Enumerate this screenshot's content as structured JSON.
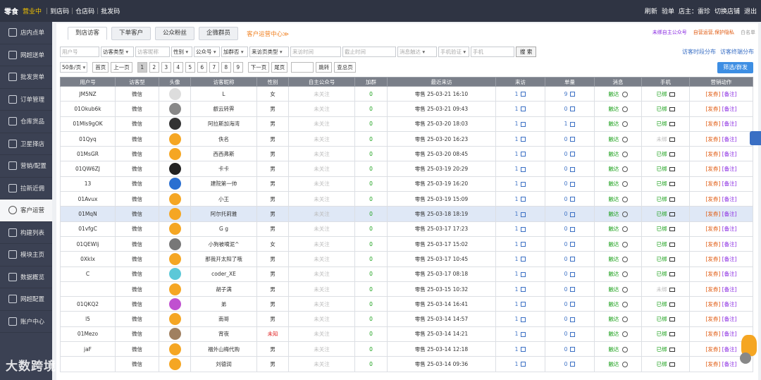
{
  "topbar": {
    "brand": "零食",
    "status": "营业中",
    "links": [
      "到店码",
      "仓店码",
      "批发码"
    ],
    "right": {
      "refresh": "刷新",
      "checkout": "验单",
      "owner": "店主：雷珍",
      "switch": "切换店铺",
      "exit": "退出"
    }
  },
  "sidebar": [
    "店内点单",
    "网超送单",
    "批发货单",
    "订单管理",
    "仓库货品",
    "卫星择店",
    "营销/配置",
    "拉新近佣",
    "客户运营",
    "构建列表",
    "模块主页",
    "数据概览",
    "网超配置",
    "账户中心"
  ],
  "watermark": "大数跨境",
  "tabs": {
    "items": [
      "到店访客",
      "下单客户",
      "公众粉丝",
      "企微群员"
    ],
    "link": "客户运营中心≫"
  },
  "notes": [
    "未绑自主公众号",
    "自营运营,保护隐私",
    "白名单"
  ],
  "filters": {
    "user_id": "用户号",
    "visitor_type": "访客类型",
    "nickname": "访客昵称",
    "gender": "性别",
    "official": "公众号",
    "group": "加群否",
    "page_type": "来访页类型",
    "visit_time": "来访时间",
    "end_time": "截止时间",
    "msg": "消息触达",
    "phone_verify": "手机验证",
    "phone": "手机",
    "search": "搜 索"
  },
  "filter_links": [
    "访客时段分布",
    "访客终端分布"
  ],
  "pager": {
    "per_page": "50条/页",
    "first": "首页",
    "prev": "上一页",
    "pages": [
      "1",
      "2",
      "3",
      "4",
      "5",
      "6",
      "7",
      "8",
      "9"
    ],
    "next": "下一页",
    "last": "尾页",
    "jump": "跳转",
    "total": "查总页"
  },
  "filter_button": "筛选/群发",
  "columns": [
    "用户号",
    "访客型",
    "头像",
    "访客昵称",
    "性别",
    "自主公众号",
    "加群",
    "最近来访",
    "来访",
    "单量",
    "消息",
    "手机",
    "营销动作"
  ],
  "rows": [
    {
      "id": "JM5NZ",
      "type": "微信",
      "name": "L",
      "gender": "女",
      "official": "未关注",
      "group": "0",
      "last": "零售 25-03-21 16:10",
      "visits": "1",
      "orders": "9",
      "msg": "触达",
      "phone": "已绑",
      "c1": "[发券]",
      "c2": "[备注]"
    },
    {
      "id": "01Okub6k",
      "type": "微信",
      "name": "叡云转霁",
      "gender": "男",
      "official": "未关注",
      "group": "0",
      "last": "零售 25-03-21 09:43",
      "visits": "1",
      "orders": "0",
      "msg": "触达",
      "phone": "已绑",
      "c1": "[发券]",
      "c2": "[备注]"
    },
    {
      "id": "01Mls9gOK",
      "type": "微信",
      "name": "阿拉斯加海湾",
      "gender": "男",
      "official": "未关注",
      "group": "0",
      "last": "零售 25-03-20 18:03",
      "visits": "1",
      "orders": "1",
      "msg": "触达",
      "phone": "已绑",
      "c1": "[发券]",
      "c2": "[备注]"
    },
    {
      "id": "01Qyq",
      "type": "微信",
      "name": "佚名",
      "gender": "男",
      "official": "未关注",
      "group": "0",
      "last": "零售 25-03-20 16:23",
      "visits": "1",
      "orders": "0",
      "msg": "触达",
      "phone": "未绑",
      "c1": "[发券]",
      "c2": "[备注]"
    },
    {
      "id": "01MsGR",
      "type": "微信",
      "name": "西西弗斯",
      "gender": "男",
      "official": "未关注",
      "group": "0",
      "last": "零售 25-03-20 08:45",
      "visits": "1",
      "orders": "0",
      "msg": "触达",
      "phone": "已绑",
      "c1": "[发券]",
      "c2": "[备注]"
    },
    {
      "id": "01QW6ZJ",
      "type": "微信",
      "name": "卡卡",
      "gender": "男",
      "official": "未关注",
      "group": "0",
      "last": "零售 25-03-19 20:29",
      "visits": "1",
      "orders": "0",
      "msg": "触达",
      "phone": "已绑",
      "c1": "[发券]",
      "c2": "[备注]"
    },
    {
      "id": "13",
      "type": "微信",
      "name": "建院第一帅",
      "gender": "男",
      "official": "未关注",
      "group": "0",
      "last": "零售 25-03-19 16:20",
      "visits": "1",
      "orders": "0",
      "msg": "触达",
      "phone": "已绑",
      "c1": "[发券]",
      "c2": "[备注]"
    },
    {
      "id": "01Avux",
      "type": "微信",
      "name": "小王",
      "gender": "男",
      "official": "未关注",
      "group": "0",
      "last": "零售 25-03-19 15:09",
      "visits": "1",
      "orders": "0",
      "msg": "触达",
      "phone": "已绑",
      "c1": "[发券]",
      "c2": "[备注]"
    },
    {
      "id": "01MqN",
      "type": "微信",
      "name": "阿尔托莉雅",
      "gender": "男",
      "official": "未关注",
      "group": "0",
      "last": "零售 25-03-18 18:19",
      "visits": "1",
      "orders": "0",
      "msg": "触达",
      "phone": "已绑",
      "c1": "[发券]",
      "c2": "[备注]"
    },
    {
      "id": "01vfgC",
      "type": "微信",
      "name": "G g",
      "gender": "男",
      "official": "未关注",
      "group": "0",
      "last": "零售 25-03-17 17:23",
      "visits": "1",
      "orders": "0",
      "msg": "触达",
      "phone": "已绑",
      "c1": "[发券]",
      "c2": "[备注]"
    },
    {
      "id": "01QEWlj",
      "type": "微信",
      "name": "小狗被嘀泥^",
      "gender": "女",
      "official": "未关注",
      "group": "0",
      "last": "零售 25-03-17 15:02",
      "visits": "1",
      "orders": "0",
      "msg": "触达",
      "phone": "已绑",
      "c1": "[发券]",
      "c2": "[备注]"
    },
    {
      "id": "0Xklx",
      "type": "微信",
      "name": "那我开太阳了哦",
      "gender": "男",
      "official": "未关注",
      "group": "0",
      "last": "零售 25-03-17 10:45",
      "visits": "1",
      "orders": "0",
      "msg": "触达",
      "phone": "已绑",
      "c1": "[发券]",
      "c2": "[备注]"
    },
    {
      "id": "C",
      "type": "微信",
      "name": "coder_XE",
      "gender": "男",
      "official": "未关注",
      "group": "0",
      "last": "零售 25-03-17 08:18",
      "visits": "1",
      "orders": "0",
      "msg": "触达",
      "phone": "已绑",
      "c1": "[发券]",
      "c2": "[备注]"
    },
    {
      "id": "",
      "type": "微信",
      "name": "胡子满",
      "gender": "男",
      "official": "未关注",
      "group": "0",
      "last": "零售 25-03-15 10:32",
      "visits": "1",
      "orders": "0",
      "msg": "触达",
      "phone": "未绑",
      "c1": "[发券]",
      "c2": "[备注]"
    },
    {
      "id": "01QKQ2",
      "type": "微信",
      "name": "弟",
      "gender": "男",
      "official": "未关注",
      "group": "0",
      "last": "零售 25-03-14 16:41",
      "visits": "1",
      "orders": "0",
      "msg": "触达",
      "phone": "已绑",
      "c1": "[发券]",
      "c2": "[备注]"
    },
    {
      "id": "l5",
      "type": "微信",
      "name": "南哥",
      "gender": "男",
      "official": "未关注",
      "group": "0",
      "last": "零售 25-03-14 14:57",
      "visits": "1",
      "orders": "0",
      "msg": "触达",
      "phone": "已绑",
      "c1": "[发券]",
      "c2": "[备注]"
    },
    {
      "id": "01Mezo",
      "type": "微信",
      "name": "宵夜",
      "gender": "未知",
      "official": "未关注",
      "group": "0",
      "last": "零售 25-03-14 14:21",
      "visits": "1",
      "orders": "0",
      "msg": "触达",
      "phone": "已绑",
      "c1": "[发券]",
      "c2": "[备注]"
    },
    {
      "id": "jaF",
      "type": "微信",
      "name": "福外山梅代购",
      "gender": "男",
      "official": "未关注",
      "group": "0",
      "last": "零售 25-03-14 12:18",
      "visits": "1",
      "orders": "0",
      "msg": "触达",
      "phone": "已绑",
      "c1": "[发券]",
      "c2": "[备注]"
    },
    {
      "id": "",
      "type": "微信",
      "name": "刘德润",
      "gender": "男",
      "official": "未关注",
      "group": "0",
      "last": "零售 25-03-14 09:36",
      "visits": "1",
      "orders": "0",
      "msg": "触达",
      "phone": "已绑",
      "c1": "[发券]",
      "c2": "[备注]"
    }
  ],
  "colors": {
    "topbar": "#2f3443",
    "sidebar": "#3b4153",
    "accent": "#3d8ee3",
    "green": "#1aa01a",
    "orange": "#e05a10",
    "purple": "#8a2be2",
    "avatars": [
      "#ddd",
      "#888",
      "#333",
      "#f5a623",
      "#f5a623",
      "#222",
      "#2a6fd1",
      "#f5a623",
      "#f5a623",
      "#f5a623",
      "#777",
      "#f5a623",
      "#5cc8d8",
      "#f5a623",
      "#c050d0",
      "#f5a623",
      "#a08060",
      "#f5a623",
      "#f5a623"
    ]
  }
}
